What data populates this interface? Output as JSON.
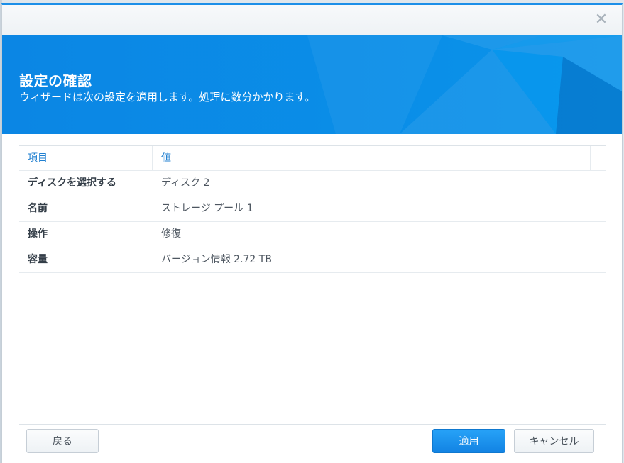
{
  "dialog": {
    "close_symbol": "✕"
  },
  "banner": {
    "title": "設定の確認",
    "subtitle": "ウィザードは次の設定を適用します。処理に数分かかります。"
  },
  "grid": {
    "header_item": "項目",
    "header_value": "値",
    "rows": [
      {
        "key": "ディスクを選択する",
        "value": "ディスク 2"
      },
      {
        "key": "名前",
        "value": "ストレージ プール 1"
      },
      {
        "key": "操作",
        "value": "修復"
      },
      {
        "key": "容量",
        "value": "バージョン情報 2.72 TB"
      }
    ]
  },
  "footer": {
    "back_label": "戻る",
    "apply_label": "適用",
    "cancel_label": "キャンセル"
  },
  "colors": {
    "accent": "#1c8fe8",
    "banner": "#0a87e6",
    "header_text": "#1f7fd0"
  },
  "icons": {
    "close": "close-icon"
  }
}
